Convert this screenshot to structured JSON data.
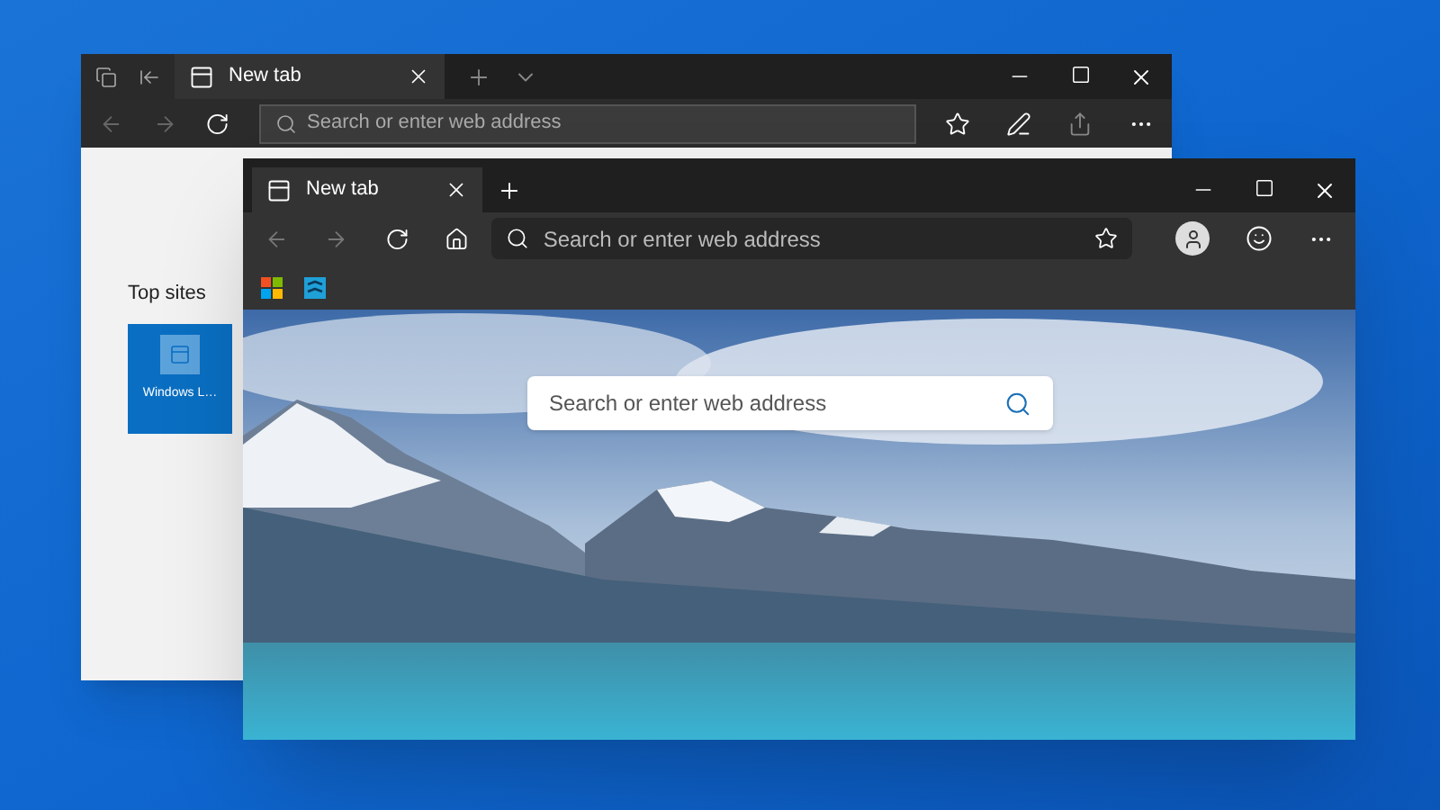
{
  "back_window": {
    "tabs": [
      {
        "title": "New tab",
        "selected": true
      }
    ],
    "address_bar": {
      "placeholder": "Search or enter web address"
    },
    "top_sites": {
      "heading": "Top sites",
      "tiles": [
        {
          "label": "Windows L…"
        }
      ]
    }
  },
  "front_window": {
    "tabs": [
      {
        "title": "New tab",
        "selected": true
      }
    ],
    "address_bar": {
      "placeholder": "Search or enter web address"
    },
    "page_search": {
      "placeholder": "Search or enter web address"
    }
  }
}
